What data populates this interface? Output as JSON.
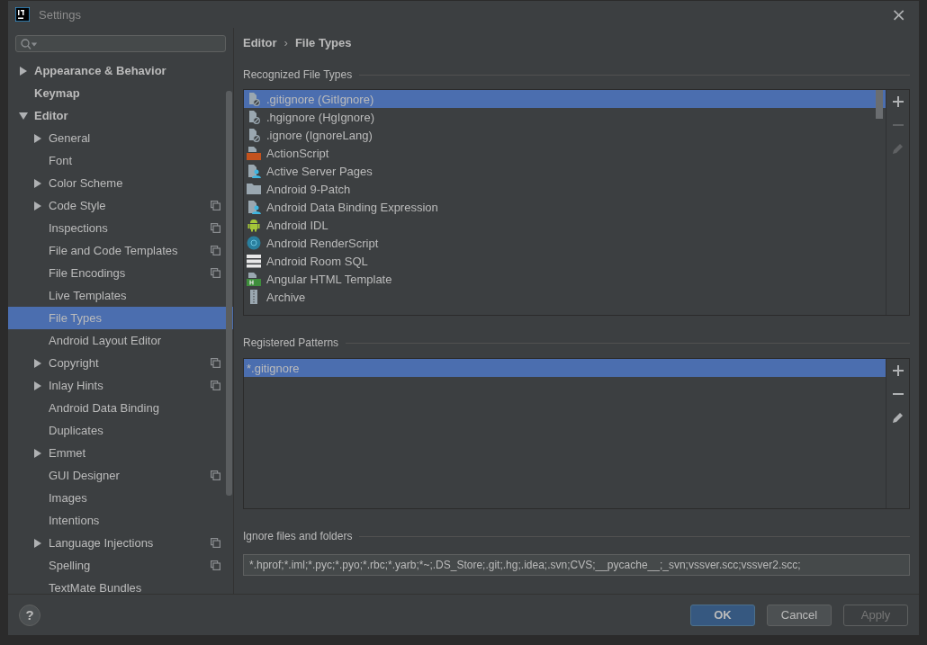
{
  "window": {
    "title": "Settings",
    "close": "×"
  },
  "sidebar": {
    "items": [
      {
        "label": "Appearance & Behavior",
        "kind": "branch",
        "expanded": false,
        "selected": false,
        "shared": false
      },
      {
        "label": "Keymap",
        "kind": "leaf",
        "selected": false,
        "shared": false
      },
      {
        "label": "Editor",
        "kind": "branch",
        "expanded": true,
        "selected": false,
        "shared": false,
        "children": [
          {
            "label": "General",
            "kind": "branch",
            "expanded": false,
            "selected": false,
            "shared": false
          },
          {
            "label": "Font",
            "kind": "leaf",
            "selected": false,
            "shared": false
          },
          {
            "label": "Color Scheme",
            "kind": "branch",
            "expanded": false,
            "selected": false,
            "shared": false
          },
          {
            "label": "Code Style",
            "kind": "branch",
            "expanded": false,
            "selected": false,
            "shared": true
          },
          {
            "label": "Inspections",
            "kind": "leaf",
            "selected": false,
            "shared": true
          },
          {
            "label": "File and Code Templates",
            "kind": "leaf",
            "selected": false,
            "shared": true
          },
          {
            "label": "File Encodings",
            "kind": "leaf",
            "selected": false,
            "shared": true
          },
          {
            "label": "Live Templates",
            "kind": "leaf",
            "selected": false,
            "shared": false
          },
          {
            "label": "File Types",
            "kind": "leaf",
            "selected": true,
            "shared": false
          },
          {
            "label": "Android Layout Editor",
            "kind": "leaf",
            "selected": false,
            "shared": false
          },
          {
            "label": "Copyright",
            "kind": "branch",
            "expanded": false,
            "selected": false,
            "shared": true
          },
          {
            "label": "Inlay Hints",
            "kind": "branch",
            "expanded": false,
            "selected": false,
            "shared": true
          },
          {
            "label": "Android Data Binding",
            "kind": "leaf",
            "selected": false,
            "shared": false
          },
          {
            "label": "Duplicates",
            "kind": "leaf",
            "selected": false,
            "shared": false
          },
          {
            "label": "Emmet",
            "kind": "branch",
            "expanded": false,
            "selected": false,
            "shared": false
          },
          {
            "label": "GUI Designer",
            "kind": "leaf",
            "selected": false,
            "shared": true
          },
          {
            "label": "Images",
            "kind": "leaf",
            "selected": false,
            "shared": false
          },
          {
            "label": "Intentions",
            "kind": "leaf",
            "selected": false,
            "shared": false
          },
          {
            "label": "Language Injections",
            "kind": "branch",
            "expanded": false,
            "selected": false,
            "shared": true
          },
          {
            "label": "Spelling",
            "kind": "leaf",
            "selected": false,
            "shared": true
          },
          {
            "label": "TextMate Bundles",
            "kind": "leaf",
            "selected": false,
            "shared": false
          }
        ]
      }
    ]
  },
  "breadcrumb": {
    "items": [
      "Editor",
      "File Types"
    ],
    "separator": "›"
  },
  "recognized_file_types": {
    "title": "Recognized File Types",
    "items": [
      {
        "label": ".gitignore (GitIgnore)",
        "kind": "ignore",
        "selected": true
      },
      {
        "label": ".hgignore (HgIgnore)",
        "kind": "ignore",
        "selected": false
      },
      {
        "label": ".ignore (IgnoreLang)",
        "kind": "ignore",
        "selected": false
      },
      {
        "label": "ActionScript",
        "kind": "actionscript",
        "selected": false
      },
      {
        "label": "Active Server Pages",
        "kind": "person-file",
        "selected": false
      },
      {
        "label": "Android 9-Patch",
        "kind": "folder",
        "selected": false
      },
      {
        "label": "Android Data Binding Expression",
        "kind": "person-file",
        "selected": false
      },
      {
        "label": "Android IDL",
        "kind": "android",
        "selected": false
      },
      {
        "label": "Android RenderScript",
        "kind": "renderscript",
        "selected": false
      },
      {
        "label": "Android Room SQL",
        "kind": "database",
        "selected": false
      },
      {
        "label": "Angular HTML Template",
        "kind": "html",
        "selected": false
      },
      {
        "label": "Archive",
        "kind": "archive",
        "selected": false
      }
    ],
    "toolbar": [
      {
        "kind": "add",
        "disabled": false
      },
      {
        "kind": "remove",
        "disabled": true
      },
      {
        "kind": "edit",
        "disabled": true
      }
    ]
  },
  "registered_patterns": {
    "title": "Registered Patterns",
    "items": [
      {
        "label": "*.gitignore",
        "selected": true
      }
    ],
    "toolbar": [
      {
        "kind": "add",
        "disabled": false
      },
      {
        "kind": "remove",
        "disabled": false
      },
      {
        "kind": "edit",
        "disabled": false
      }
    ]
  },
  "ignore_files": {
    "title": "Ignore files and folders",
    "value": "*.hprof;*.iml;*.pyc;*.pyo;*.rbc;*.yarb;*~;.DS_Store;.git;.hg;.idea;.svn;CVS;__pycache__;_svn;vssver.scc;vssver2.scc;"
  },
  "footer": {
    "help": "?",
    "buttons": [
      {
        "label": "OK",
        "kind": "default",
        "disabled": false
      },
      {
        "label": "Cancel",
        "kind": "normal",
        "disabled": false
      },
      {
        "label": "Apply",
        "kind": "normal",
        "disabled": true
      }
    ]
  }
}
